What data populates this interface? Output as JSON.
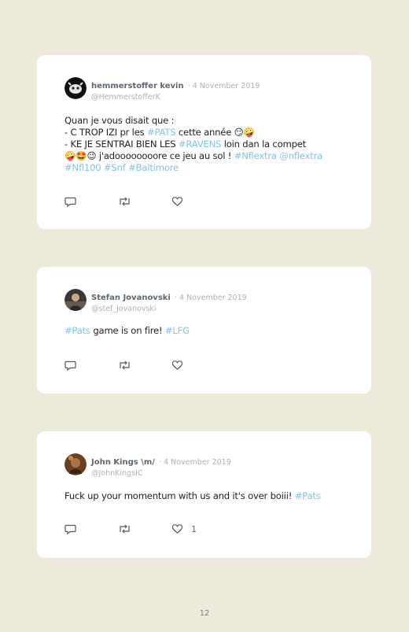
{
  "tweets": [
    {
      "author_name": "hemmerstoffer kevin",
      "date": "· 4 November 2019",
      "handle": "@HemmerstofferK",
      "line1": "Quan je vous disait que :",
      "line2a": "- C TROP IZI pr les ",
      "line2_tag": "#PATS",
      "line2b": " cette année 😏🤪",
      "line3a": "- KE JE SENTRAI BIEN LES ",
      "line3_tag": "#RAVENS",
      "line3b": " loin dan la compet",
      "line4a": "🤪🤩😉 j'adoooooooore ce jeu au sol ! ",
      "line4_tag1": "#Nflextra",
      "line4_tag2": "@nflextra",
      "line5_tag1": "#Nfl100",
      "line5_tag2": "#Snf",
      "line5_tag3": "#Baltimore",
      "like_count": "",
      "avatar_icon": "person-portrait-icon"
    },
    {
      "author_name": "Stefan Jovanovski",
      "date": "· 4 November 2019",
      "handle": "@stef_jovanovski",
      "text_tag1": "#Pats",
      "text_mid": " game is on fire! ",
      "text_tag2": "#LFG",
      "like_count": "",
      "avatar_icon": "person-portrait-icon"
    },
    {
      "author_name": "John Kings \\m/",
      "date": "· 4 November 2019",
      "handle": "@JohnKingsIC",
      "text_main": "Fuck up your momentum with us and it's over boiii! ",
      "text_tag": "#Pats",
      "like_count": "1",
      "avatar_icon": "person-portrait-icon"
    }
  ],
  "icons": {
    "reply": "reply-icon",
    "retweet": "retweet-icon",
    "like": "heart-icon"
  },
  "colors": {
    "background": "#edeadb",
    "card": "#ffffff",
    "hashtag": "#7fc4e6",
    "muted": "#a9b1b8"
  },
  "page_number": "12"
}
